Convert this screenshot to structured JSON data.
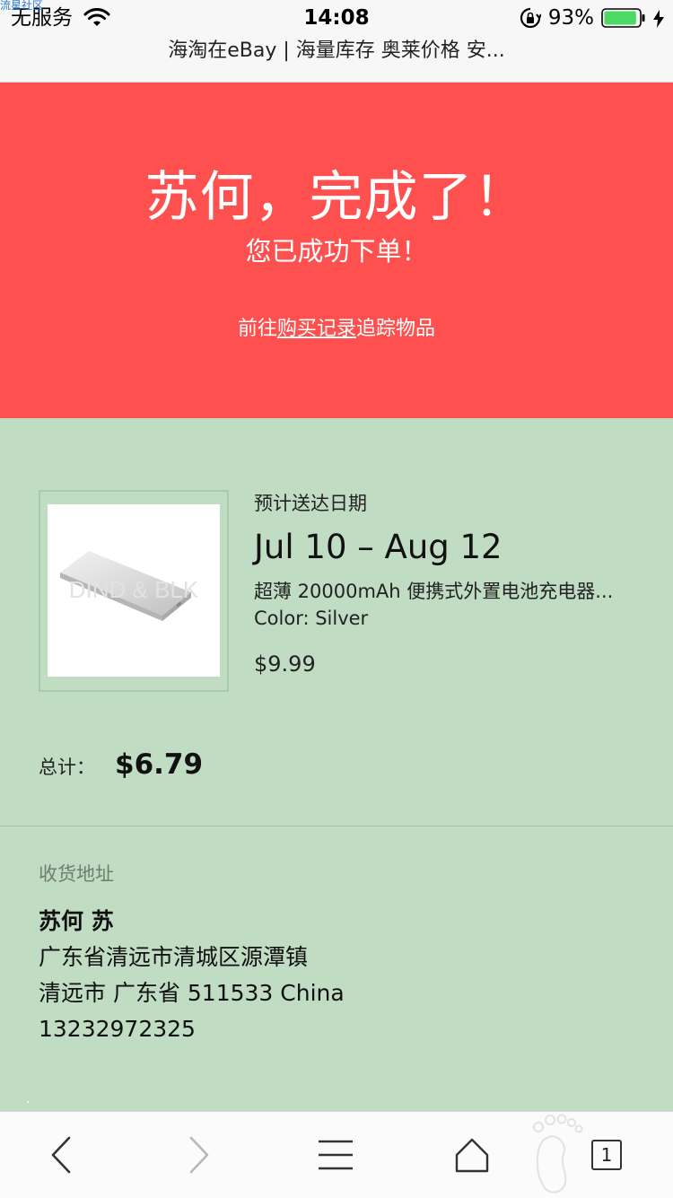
{
  "status_bar": {
    "corner_watermark": "流星社区",
    "carrier": "无服务",
    "time": "14:08",
    "battery_percent": "93%",
    "battery_level": 0.93,
    "battery_color": "#4cd964"
  },
  "browser": {
    "page_title": "海淘在eBay | 海量库存 奥莱价格 安..."
  },
  "hero": {
    "title": "苏何，完成了！",
    "subtitle": "您已成功下单！",
    "track_prefix": "前往",
    "track_link": "购买记录",
    "track_suffix": "追踪物品",
    "background_color": "#ff5050"
  },
  "order": {
    "delivery_label": "预计送达日期",
    "delivery_dates": "Jul 10 – Aug 12",
    "item_title": "超薄 20000mAh 便携式外置电池充电器...",
    "item_variant": "Color: Silver",
    "item_price": "$9.99",
    "image_watermark": "DIND & BLK",
    "total_label": "总计：",
    "total_value": "$6.79"
  },
  "shipping": {
    "heading": "收货地址",
    "name": "苏何 苏",
    "line1": "广东省清远市清城区源潭镇",
    "line2": "清远市 广东省 511533 China",
    "phone": "13232972325"
  },
  "toolbar": {
    "icons": [
      "back-icon",
      "forward-icon",
      "menu-icon",
      "home-icon",
      "tabs-icon"
    ],
    "tabs_count": "1"
  },
  "colors": {
    "section_green": "#c0dcc3"
  }
}
